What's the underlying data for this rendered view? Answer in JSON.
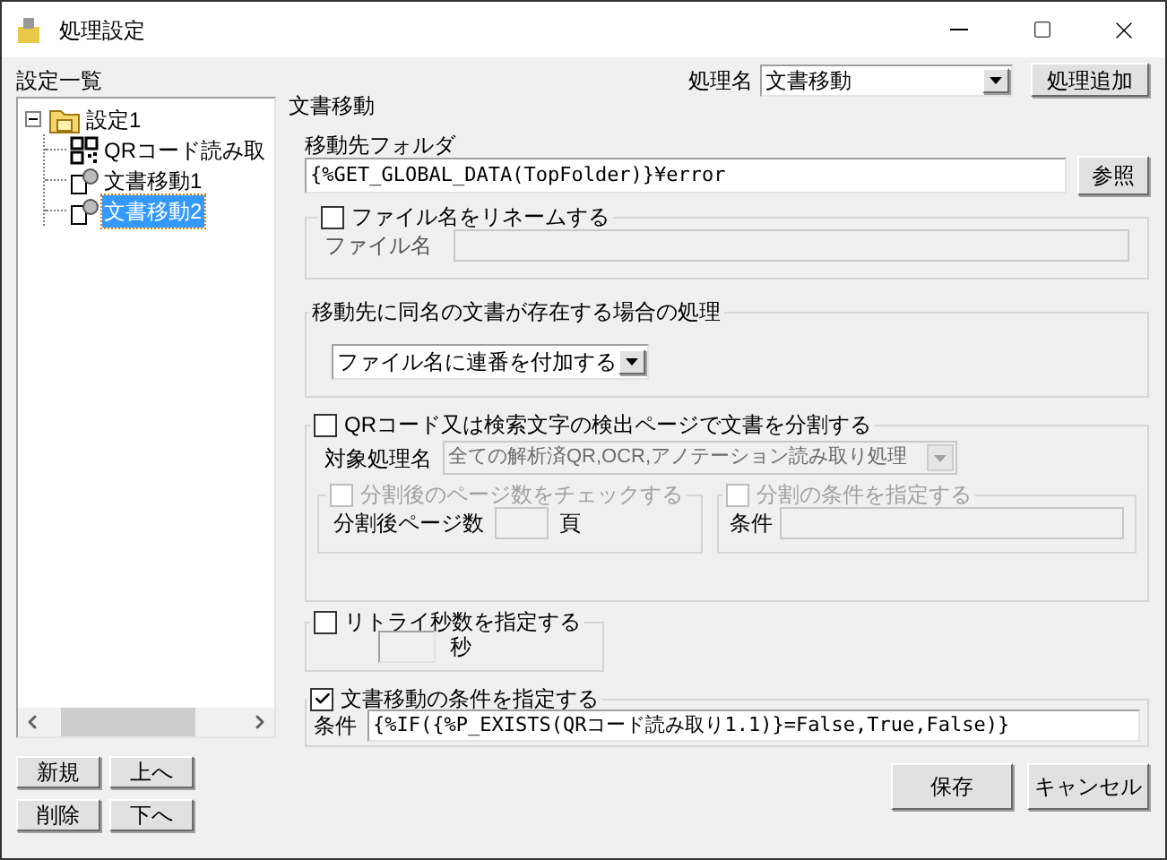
{
  "window": {
    "title": "処理設定"
  },
  "sidebar": {
    "title": "設定一覧",
    "tree": [
      {
        "label": "設定1",
        "kind": "folder",
        "expanded": true,
        "selected": false,
        "children": [
          {
            "label": "QRコード読み取",
            "kind": "qr",
            "selected": false
          },
          {
            "label": "文書移動1",
            "kind": "doc",
            "selected": false
          },
          {
            "label": "文書移動2",
            "kind": "doc",
            "selected": true
          }
        ]
      }
    ],
    "buttons": [
      "新規",
      "上へ",
      "削除",
      "下へ"
    ]
  },
  "process": {
    "label": "処理名",
    "value": "文書移動",
    "add_button": "処理追加"
  },
  "section_title": "文書移動",
  "destination": {
    "label": "移動先フォルダ",
    "value": "{%GET_GLOBAL_DATA(TopFolder)}¥error",
    "browse_button": "参照"
  },
  "rename": {
    "label": "ファイル名をリネームする",
    "checked": false,
    "field_label": "ファイル名"
  },
  "duplicate": {
    "title": "移動先に同名の文書が存在する場合の処理",
    "value": "ファイル名に連番を付加する"
  },
  "split": {
    "label": "QRコード又は検索文字の検出ページで文書を分割する",
    "checked": false,
    "target_label": "対象処理名",
    "target_value": "全ての解析済QR,OCR,アノテーション読み取り処理",
    "page_check": {
      "label": "分割後のページ数をチェックする",
      "checked": false,
      "field_label": "分割後ページ数",
      "unit": "頁"
    },
    "condition": {
      "label": "分割の条件を指定する",
      "checked": false,
      "field_label": "条件"
    }
  },
  "retry": {
    "label": "リトライ秒数を指定する",
    "checked": false,
    "unit": "秒"
  },
  "move_condition": {
    "label": "文書移動の条件を指定する",
    "checked": true,
    "field_label": "条件",
    "value": "{%IF({%P_EXISTS(QRコード読み取り1.1)}=False,True,False)}"
  },
  "buttons": [
    "保存",
    "キャンセル"
  ]
}
